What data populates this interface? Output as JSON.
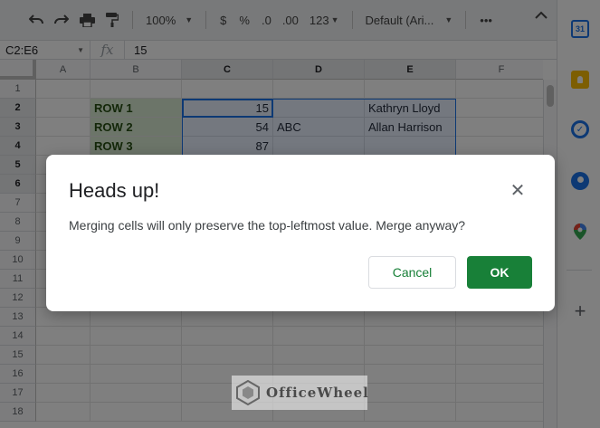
{
  "toolbar": {
    "zoom": "100%",
    "currency": "$",
    "percent": "%",
    "decrease_decimal": ".0",
    "increase_decimal": ".00",
    "number_format": "123",
    "font": "Default (Ari...",
    "more": "•••"
  },
  "formula_bar": {
    "cell_ref": "C2:E6",
    "fx": "fx",
    "value": "15"
  },
  "columns": [
    "A",
    "B",
    "C",
    "D",
    "E",
    "F"
  ],
  "rows": [
    "1",
    "2",
    "3",
    "4",
    "5",
    "6",
    "7",
    "8",
    "9",
    "10",
    "11",
    "12",
    "13",
    "14",
    "15",
    "16",
    "17",
    "18"
  ],
  "cells": {
    "B2": "ROW 1",
    "C2": "15",
    "E2": "Kathryn Lloyd",
    "B3": "ROW 2",
    "C3": "54",
    "D3": "ABC",
    "E3": "Allan Harrison",
    "B4": "ROW 3",
    "C4": "87"
  },
  "side_panel": {
    "calendar_day": "31"
  },
  "dialog": {
    "title": "Heads up!",
    "close": "✕",
    "message": "Merging cells will only preserve the top-leftmost value. Merge anyway?",
    "cancel_label": "Cancel",
    "ok_label": "OK"
  },
  "watermark": {
    "text": "OfficeWheel"
  },
  "colors": {
    "accent": "#1a73e8",
    "ok_button": "#188038",
    "row_label_fill": "#d9ead3"
  }
}
